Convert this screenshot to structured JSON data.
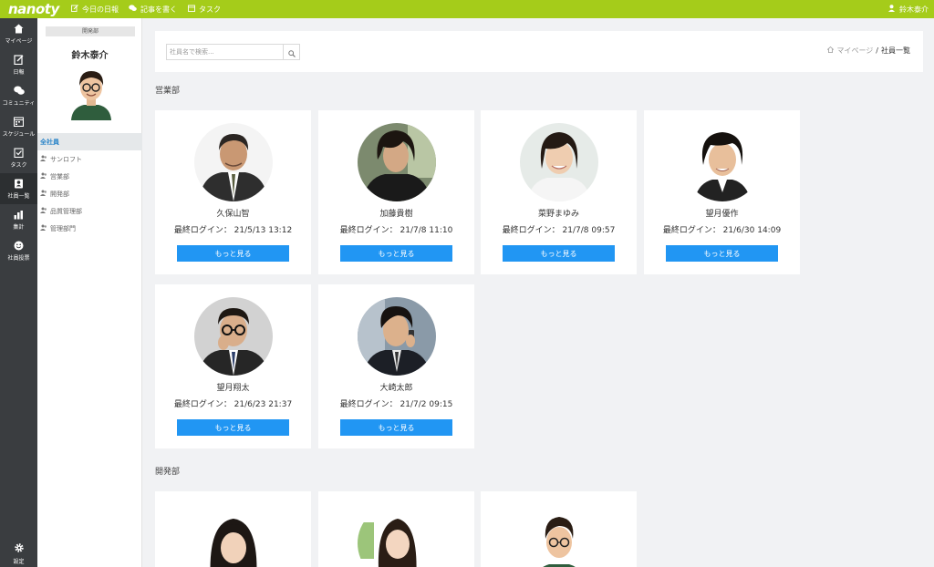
{
  "app": {
    "logo": "nanoty"
  },
  "topnav": {
    "items": [
      {
        "label": "今日の日報",
        "icon": "edit-icon"
      },
      {
        "label": "記事を書く",
        "icon": "chat-icon"
      },
      {
        "label": "タスク",
        "icon": "calendar-icon"
      }
    ],
    "user_name": "鈴木泰介"
  },
  "rail": {
    "items": [
      {
        "label": "マイページ",
        "icon": "home-icon"
      },
      {
        "label": "日報",
        "icon": "report-icon"
      },
      {
        "label": "コミュニティ",
        "icon": "community-icon"
      },
      {
        "label": "スケジュール",
        "icon": "schedule-icon"
      },
      {
        "label": "タスク",
        "icon": "task-icon"
      },
      {
        "label": "社員一覧",
        "icon": "employee-icon"
      },
      {
        "label": "集計",
        "icon": "chart-icon"
      },
      {
        "label": "社員投票",
        "icon": "vote-icon"
      }
    ],
    "settings_label": "設定"
  },
  "sidebar": {
    "department": "開発部",
    "user_name": "鈴木泰介",
    "menu": [
      {
        "label": "全社員",
        "active": true
      },
      {
        "label": "サンロフト"
      },
      {
        "label": "営業部"
      },
      {
        "label": "開発部"
      },
      {
        "label": "品質管理部"
      },
      {
        "label": "管理部門"
      }
    ]
  },
  "search": {
    "placeholder": "社員名で検索..."
  },
  "breadcrumb": {
    "home": "マイページ",
    "current": "社員一覧"
  },
  "sections": [
    {
      "title": "営業部",
      "employees": [
        {
          "name": "久保山智",
          "login": "最終ログイン： 21/5/13 13:12"
        },
        {
          "name": "加藤貴樹",
          "login": "最終ログイン： 21/7/8 11:10"
        },
        {
          "name": "菜野まゆみ",
          "login": "最終ログイン： 21/7/8 09:57"
        },
        {
          "name": "望月優作",
          "login": "最終ログイン： 21/6/30 14:09"
        },
        {
          "name": "望月翔太",
          "login": "最終ログイン： 21/6/23 21:37"
        },
        {
          "name": "大崎太郎",
          "login": "最終ログイン： 21/7/2 09:15"
        }
      ]
    },
    {
      "title": "開発部"
    }
  ],
  "card_button_label": "もっと見る",
  "colors": {
    "brand": "#a5cc1a",
    "rail": "#3a3d40",
    "button": "#2196f3",
    "active_link": "#2a84c9"
  }
}
